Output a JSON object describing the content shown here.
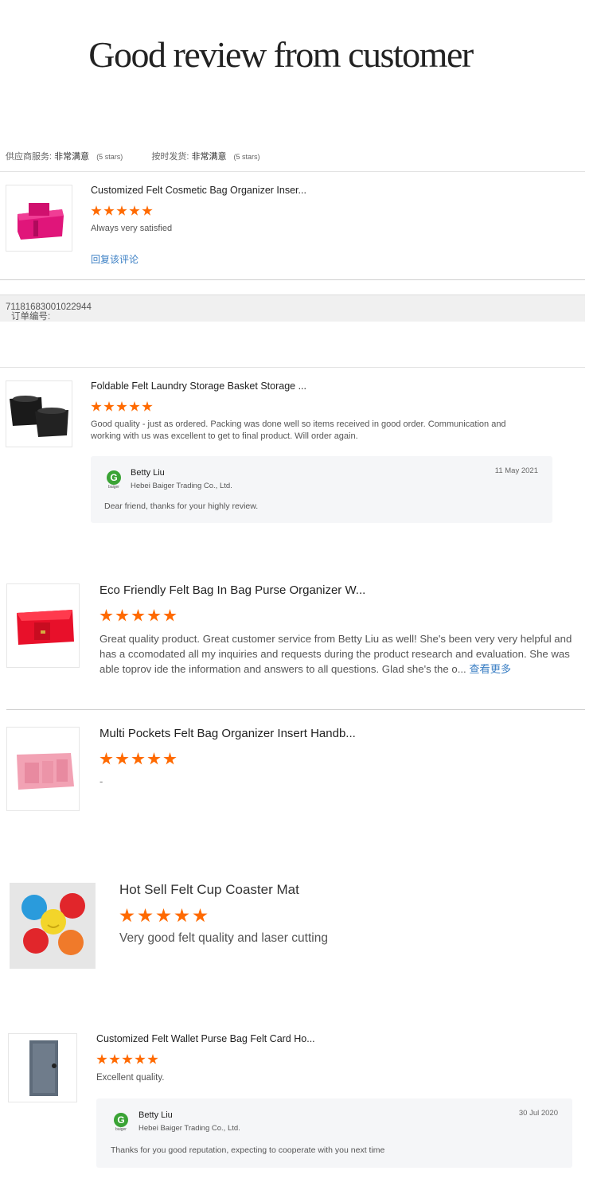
{
  "header": {
    "title": "Good review from customer"
  },
  "rating_summary": {
    "supplier_service_label": "供应商服务:",
    "supplier_service_value": "非常满意",
    "supplier_service_stars": "(5 stars)",
    "ontime_label": "按时发货:",
    "ontime_value": "非常满意",
    "ontime_stars": "(5 stars)"
  },
  "reviews": [
    {
      "product": "Customized Felt Cosmetic Bag Organizer Inser...",
      "rating": 5,
      "text": "Always very satisfied",
      "reply_link": "回复该评论"
    },
    {
      "product": "Foldable Felt Laundry Storage Basket Storage ...",
      "rating": 5,
      "text": "Good quality - just as ordered. Packing was done well so items received in good order. Communication and working with us was excellent to get to final product. Will order again.",
      "reply": {
        "name": "Betty Liu",
        "company": "Hebei Baiger Trading Co., Ltd.",
        "date": "11 May 2021",
        "message": "Dear friend, thanks for your highly review."
      }
    },
    {
      "product": "Eco Friendly Felt Bag In Bag Purse Organizer W...",
      "rating": 5,
      "text": "Great quality product. Great customer service from Betty Liu as well! She's been very very helpful and has a ccomodated all my inquiries and requests during the product research and evaluation. She was able toprov ide the information and answers to all questions. Glad she's the o...",
      "more_link": "查看更多"
    },
    {
      "product": "Multi Pockets Felt Bag Organizer Insert Handb...",
      "rating": 5,
      "text": "-"
    },
    {
      "product": "Hot Sell Felt Cup Coaster Mat",
      "rating": 5,
      "text": "Very good felt quality and laser cutting"
    },
    {
      "product": "Customized Felt Wallet Purse Bag Felt Card Ho...",
      "rating": 5,
      "text": "Excellent quality.",
      "reply": {
        "name": "Betty Liu",
        "company": "Hebei Baiger Trading Co., Ltd.",
        "date": "30 Jul 2020",
        "message": "Thanks for you good reputation, expecting to cooperate with you next time"
      }
    }
  ],
  "order": {
    "label": "订单编号:",
    "number": "71181683001022944"
  },
  "logo": {
    "letter": "G",
    "text": "baiger"
  },
  "colors": {
    "star": "#ff6a00",
    "link": "#3b7fc4",
    "logo": "#3aa335"
  }
}
